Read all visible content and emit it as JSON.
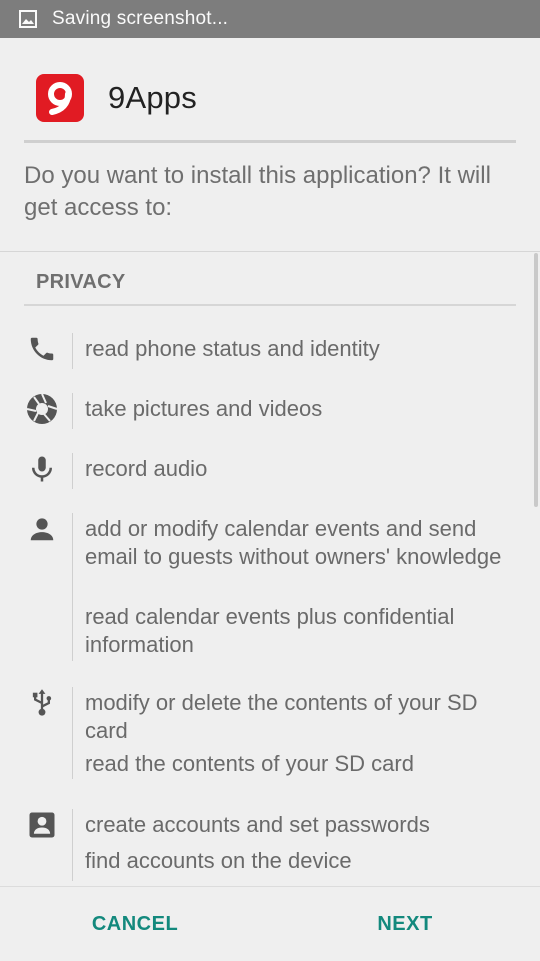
{
  "status_bar": {
    "text": "Saving screenshot..."
  },
  "app": {
    "name": "9Apps",
    "icon_glyph": "9",
    "icon_color": "#e11b23"
  },
  "prompt": "Do you want to install this application? It will get access to:",
  "section": "PRIVACY",
  "permissions": [
    {
      "icon": "phone-icon",
      "lines": [
        "read phone status and identity"
      ]
    },
    {
      "icon": "camera-icon",
      "lines": [
        "take pictures and videos"
      ]
    },
    {
      "icon": "microphone-icon",
      "lines": [
        "record audio"
      ]
    },
    {
      "icon": "person-icon",
      "lines": [
        "add or modify calendar events and send email to guests without owners' knowledge",
        "read calendar events plus confidential information"
      ]
    },
    {
      "icon": "usb-icon",
      "lines": [
        "modify or delete the contents of your SD card",
        "read the contents of your SD card"
      ]
    },
    {
      "icon": "contact-card-icon",
      "lines": [
        "create accounts and set passwords",
        "find accounts on the device"
      ]
    }
  ],
  "buttons": {
    "cancel": "CANCEL",
    "next": "NEXT"
  },
  "colors": {
    "accent": "#13897d",
    "status_bar": "#7d7d7d"
  }
}
